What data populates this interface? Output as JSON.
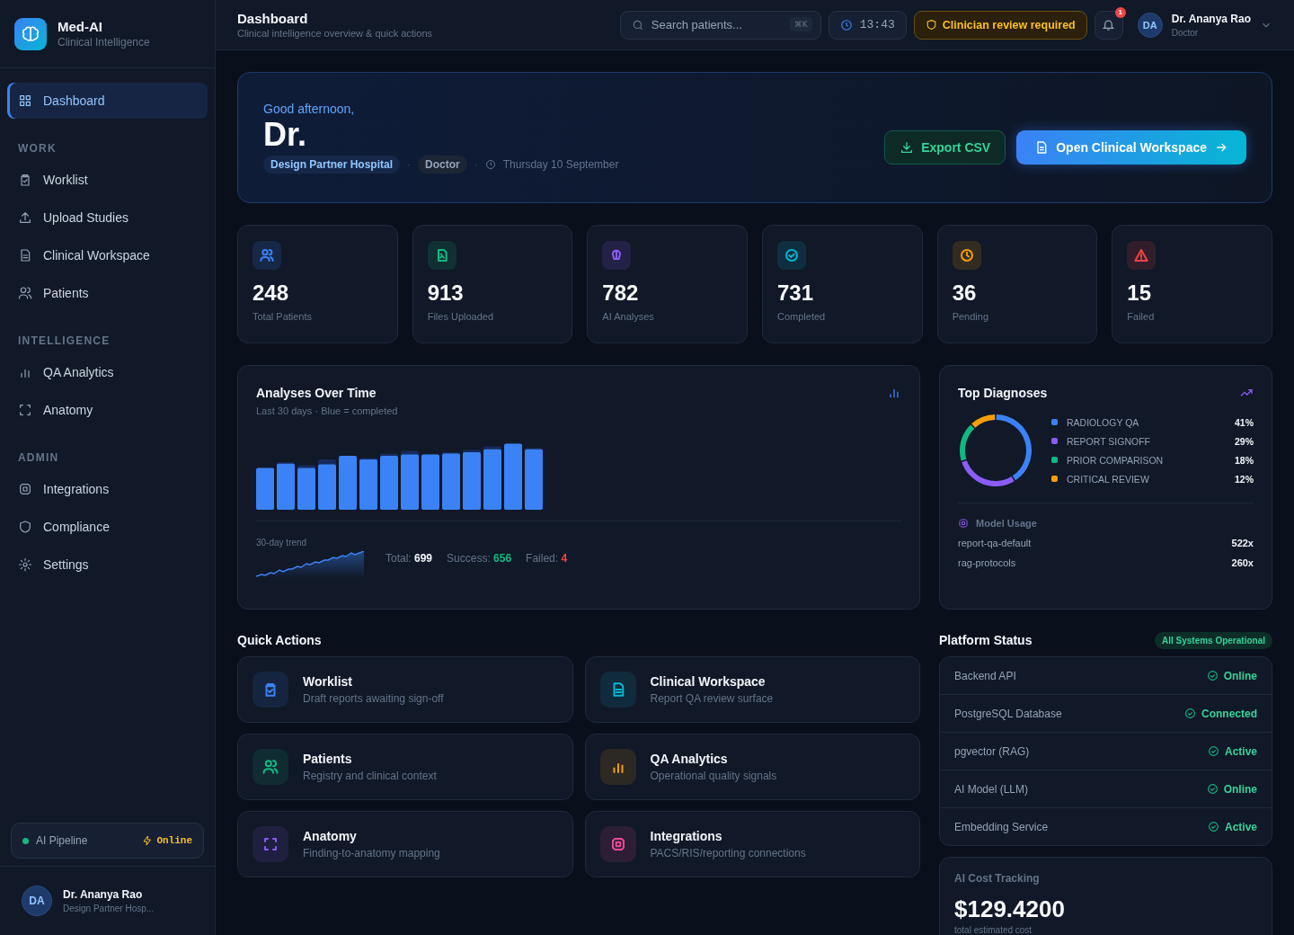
{
  "brand": {
    "name": "Med-AI",
    "tagline": "Clinical Intelligence"
  },
  "sidebar": {
    "sections": [
      {
        "items": [
          {
            "label": "Dashboard",
            "selected": true
          }
        ]
      },
      {
        "title": "WORK",
        "items": [
          {
            "label": "Worklist",
            "selected": false
          },
          {
            "label": "Upload Studies",
            "selected": false
          },
          {
            "label": "Clinical Workspace",
            "selected": false
          },
          {
            "label": "Patients",
            "selected": false
          }
        ]
      },
      {
        "title": "INTELLIGENCE",
        "items": [
          {
            "label": "QA Analytics",
            "selected": false
          },
          {
            "label": "Anatomy",
            "selected": false
          }
        ]
      },
      {
        "title": "ADMIN",
        "items": [
          {
            "label": "Integrations",
            "selected": false
          },
          {
            "label": "Compliance",
            "selected": false
          },
          {
            "label": "Settings",
            "selected": false
          }
        ]
      }
    ],
    "pipeline": {
      "label": "AI Pipeline",
      "status": "Online"
    },
    "user": {
      "initials": "DA",
      "name": "Dr. Ananya Rao",
      "org": "Design Partner Hosp..."
    }
  },
  "header": {
    "title": "Dashboard",
    "subtitle": "Clinical intelligence overview & quick actions",
    "search": {
      "placeholder": "Search patients...",
      "shortcut": "⌘K"
    },
    "time": "13:43",
    "warning": "Clinician review required",
    "notifications": "1",
    "user": {
      "initials": "DA",
      "name": "Dr. Ananya Rao",
      "role": "Doctor"
    }
  },
  "hero": {
    "greeting": "Good afternoon,",
    "name": "Dr.",
    "org": "Design Partner Hospital",
    "role": "Doctor",
    "separators": [
      "·",
      "·"
    ],
    "date": "Thursday 10 September",
    "buttons": [
      {
        "label": "Export CSV",
        "kind": "secondary"
      },
      {
        "label": "Open Clinical Workspace",
        "kind": "primary"
      }
    ]
  },
  "stats": [
    {
      "value": "248",
      "label": "Total Patients",
      "color": "#3b82f6"
    },
    {
      "value": "913",
      "label": "Files Uploaded",
      "color": "#10b981"
    },
    {
      "value": "782",
      "label": "AI Analyses",
      "color": "#8b5cf6"
    },
    {
      "value": "731",
      "label": "Completed",
      "color": "#06b6d4"
    },
    {
      "value": "36",
      "label": "Pending",
      "color": "#f59e0b"
    },
    {
      "value": "15",
      "label": "Failed",
      "color": "#ef4444"
    }
  ],
  "analyses": {
    "title": "Analyses Over Time",
    "subtitle": "Last 30 days · Blue = completed",
    "trend_label": "30-day trend",
    "totals": [
      {
        "label": "Total:",
        "value": "699",
        "kind": "total"
      },
      {
        "label": "Success:",
        "value": "656",
        "kind": "success"
      },
      {
        "label": "Failed:",
        "value": "4",
        "kind": "failed"
      }
    ]
  },
  "top_diagnoses": {
    "title": "Top Diagnoses",
    "legend": [
      {
        "value": "41%",
        "color": "#3b82f6"
      },
      {
        "value": "29%",
        "color": "#8b5cf6"
      },
      {
        "value": "18%",
        "color": "#10b981"
      },
      {
        "value": "12%",
        "color": "#f59e0b"
      }
    ],
    "chart_data": {
      "type": "donut",
      "categories": [
        "RADIOLOGY QA",
        "REPORT SIGNOFF",
        "PRIOR COMPARISON",
        "CRITICAL REVIEW"
      ],
      "values": [
        41,
        29,
        18,
        12
      ]
    },
    "model_usage": {
      "title": "Model Usage",
      "rows": [
        {
          "name": "report-qa-default",
          "count": "522x"
        },
        {
          "name": "rag-protocols",
          "count": "260x"
        }
      ]
    }
  },
  "quick_actions": {
    "title": "Quick Actions",
    "items": [
      {
        "title": "Worklist",
        "subtitle": "Draft reports awaiting sign-off",
        "color": "#3b82f6"
      },
      {
        "title": "Clinical Workspace",
        "subtitle": "Report QA review surface",
        "color": "#06b6d4"
      },
      {
        "title": "Patients",
        "subtitle": "Registry and clinical context",
        "color": "#10b981"
      },
      {
        "title": "QA Analytics",
        "subtitle": "Operational quality signals",
        "color": "#f59e0b"
      },
      {
        "title": "Anatomy",
        "subtitle": "Finding-to-anatomy mapping",
        "color": "#8b5cf6"
      },
      {
        "title": "Integrations",
        "subtitle": "PACS/RIS/reporting connections",
        "color": "#ec4899"
      }
    ]
  },
  "platform_status": {
    "title": "Platform Status",
    "badge": "All Systems Operational",
    "rows": [
      {
        "name": "Backend API",
        "status": "Online"
      },
      {
        "name": "PostgreSQL Database",
        "status": "Connected"
      },
      {
        "name": "pgvector (RAG)",
        "status": "Active"
      },
      {
        "name": "AI Model (LLM)",
        "status": "Online"
      },
      {
        "name": "Embedding Service",
        "status": "Active"
      }
    ]
  },
  "cost": {
    "title": "AI Cost Tracking",
    "value": "$129.4200",
    "caption": "total estimated cost"
  }
}
